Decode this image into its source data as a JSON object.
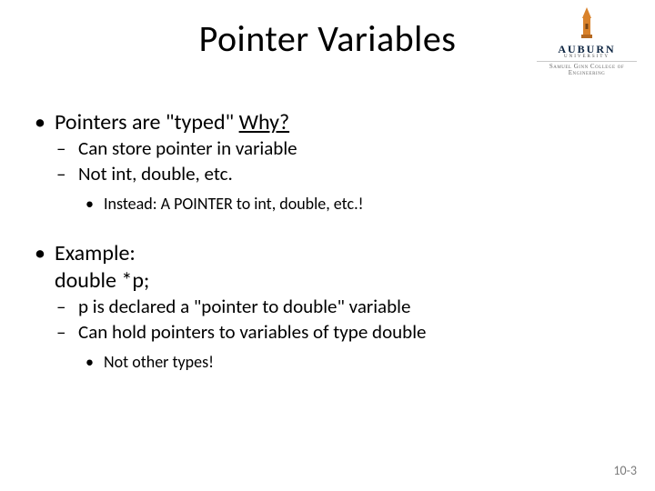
{
  "title": "Pointer Variables",
  "logo": {
    "name": "AUBURN",
    "sub": "UNIVERSITY",
    "college": "Samuel Ginn College of Engineering"
  },
  "bullets": {
    "b1_prefix": "Pointers are \"typed\"   ",
    "b1_link": "Why?",
    "b1a": "Can store pointer in variable",
    "b1b": "Not int, double, etc.",
    "b1b1": "Instead: A POINTER to int, double, etc.!",
    "b2_line1": "Example:",
    "b2_line2": "double *p;",
    "b2a": "p is declared a \"pointer to double\" variable",
    "b2b": "Can hold pointers to variables of type double",
    "b2b1": "Not other types!"
  },
  "slide_number": "10-3"
}
